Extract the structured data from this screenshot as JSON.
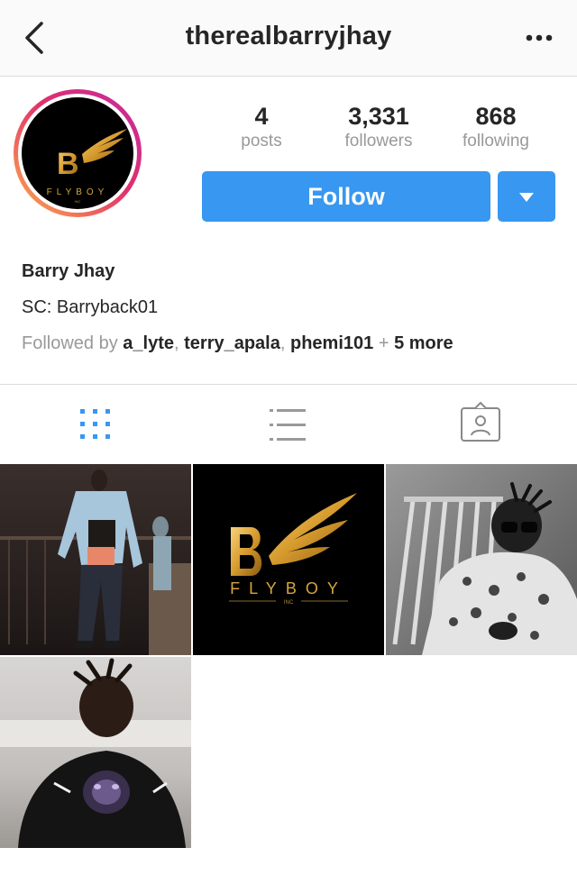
{
  "header": {
    "title": "therealbarryjhay"
  },
  "avatar": {
    "logo_text": "FLYBOY",
    "logo_sub": "INC",
    "logo_letter": "B"
  },
  "stats": [
    {
      "value": "4",
      "label": "posts"
    },
    {
      "value": "3,331",
      "label": "followers"
    },
    {
      "value": "868",
      "label": "following"
    }
  ],
  "actions": {
    "follow_label": "Follow"
  },
  "profile": {
    "name": "Barry Jhay",
    "bio": "SC: Barryback01",
    "followed_by_prefix": "Followed by",
    "followed_by_users": [
      "a_lyte",
      "terry_apala",
      "phemi101"
    ],
    "followed_by_more": "5 more",
    "sep1": ", ",
    "sep2": ", ",
    "plus": " + "
  },
  "tabs": [
    {
      "icon": "grid-icon",
      "active": true
    },
    {
      "icon": "list-icon",
      "active": false
    },
    {
      "icon": "tagged-icon",
      "active": false
    }
  ],
  "posts_grid": {
    "post2_logo_text": "FLYBOY",
    "post2_logo_sub": "INC"
  },
  "colors": {
    "accent": "#3897f0",
    "muted": "#999999",
    "text": "#262626"
  }
}
